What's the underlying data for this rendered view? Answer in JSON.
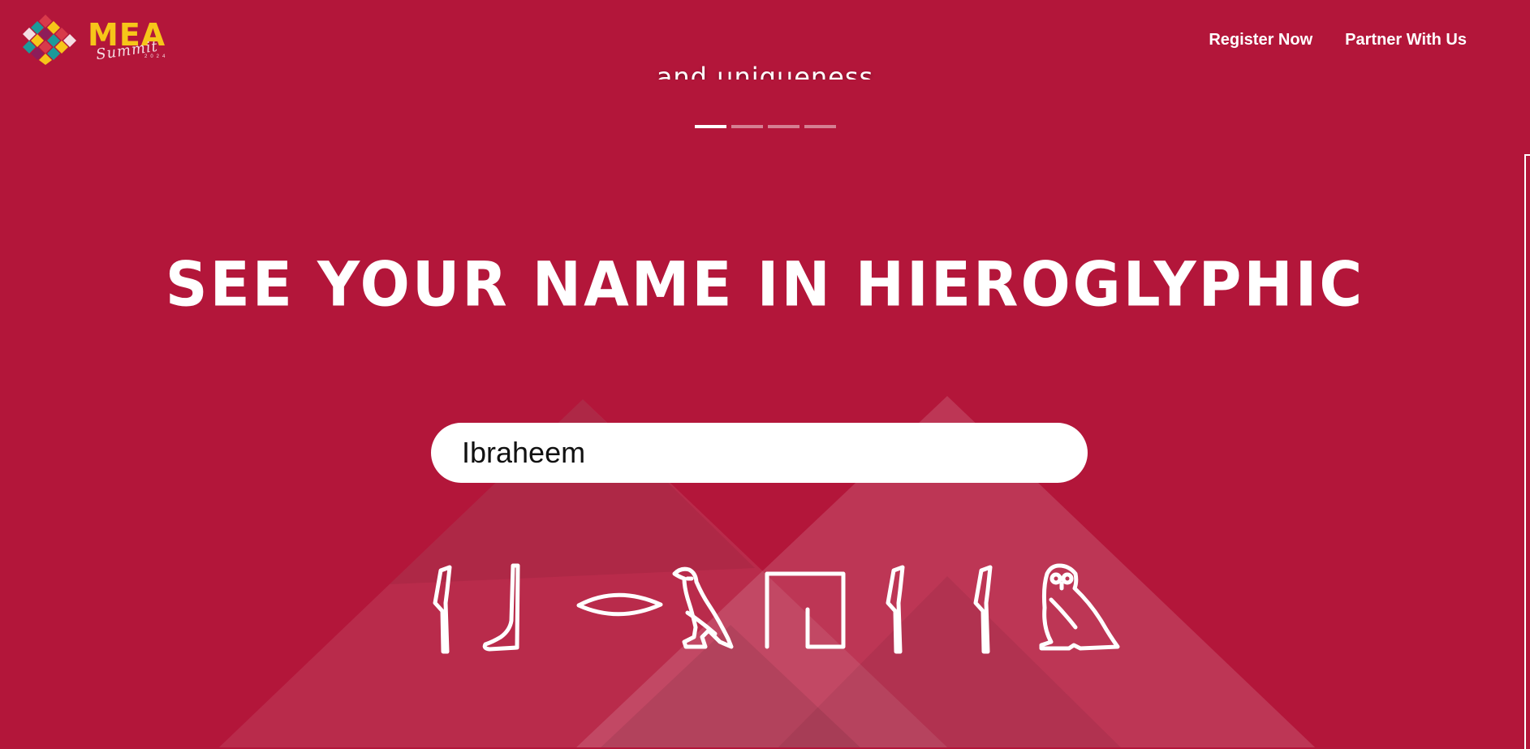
{
  "brand": {
    "name": "MEA",
    "script": "Summit",
    "year": "2024",
    "colors": {
      "gold": "#f6c619",
      "teal": "#1c9a9a",
      "red": "#d83a4a"
    }
  },
  "nav": {
    "items": [
      "Register Now",
      "Partner With Us"
    ]
  },
  "hero": {
    "caption": "and uniqueness",
    "slide_count": 4,
    "active_slide": 1
  },
  "section": {
    "title": "SEE YOUR NAME IN HIEROGLYPHIC",
    "input_value": "Ibraheem"
  },
  "hieroglyphs": [
    "reed-leaf-icon",
    "foot-icon",
    "mouth-icon",
    "vulture-icon",
    "reed-shelter-icon",
    "reed-leaf-icon",
    "reed-leaf-icon",
    "owl-icon"
  ],
  "colors": {
    "background": "#b3163a",
    "text": "#ffffff"
  }
}
